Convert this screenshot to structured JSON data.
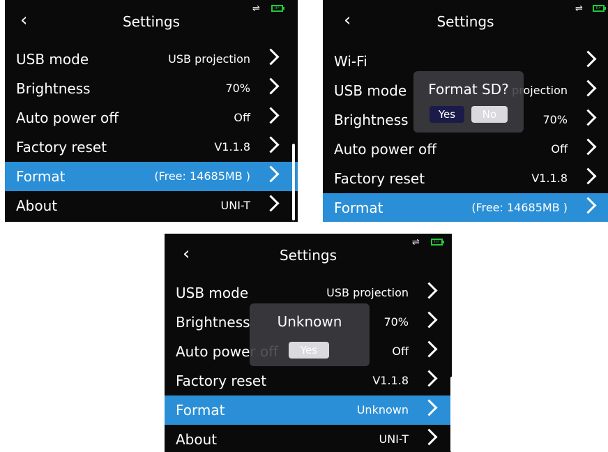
{
  "screen1": {
    "title": "Settings",
    "back_icon": "‹",
    "usb_icon": "⇌",
    "battery_icon": "II⚡",
    "rows": [
      {
        "label": "USB mode",
        "value": "USB projection"
      },
      {
        "label": "Brightness",
        "value": "70%"
      },
      {
        "label": "Auto power off",
        "value": "Off"
      },
      {
        "label": "Factory reset",
        "value": "V1.1.8"
      },
      {
        "label": "Format",
        "value": "(Free: 14685MB )"
      },
      {
        "label": "About",
        "value": "UNI-T"
      }
    ],
    "selected_index": 4
  },
  "screen2": {
    "title": "Settings",
    "back_icon": "‹",
    "usb_icon": "⇌",
    "battery_icon": "II⚡",
    "rows": [
      {
        "label": "Wi-Fi",
        "value": ""
      },
      {
        "label": "USB mode",
        "value": "projection"
      },
      {
        "label": "Brightness",
        "value": "70%"
      },
      {
        "label": "Auto power off",
        "value": "Off"
      },
      {
        "label": "Factory reset",
        "value": "V1.1.8"
      },
      {
        "label": "Format",
        "value": "(Free: 14685MB )"
      }
    ],
    "selected_index": 5,
    "dialog": {
      "title": "Format SD?",
      "yes": "Yes",
      "no": "No"
    }
  },
  "screen3": {
    "title": "Settings",
    "back_icon": "‹",
    "usb_icon": "⇌",
    "battery_icon": "II⚡",
    "rows": [
      {
        "label": "USB mode",
        "value": "USB projection"
      },
      {
        "label": "Brightness",
        "value": "70%"
      },
      {
        "label": "Auto power off",
        "value": "Off"
      },
      {
        "label": "Factory reset",
        "value": "V1.1.8"
      },
      {
        "label": "Format",
        "value": "Unknown"
      },
      {
        "label": "About",
        "value": "UNI-T"
      }
    ],
    "selected_index": 4,
    "dialog": {
      "title": "Unknown",
      "yes": "Yes"
    }
  },
  "colors": {
    "screen_bg": "#0a0a0a",
    "selected_row": "#2a8fd6",
    "battery": "#22c93a",
    "dialog_bg": "#3c3c42"
  }
}
